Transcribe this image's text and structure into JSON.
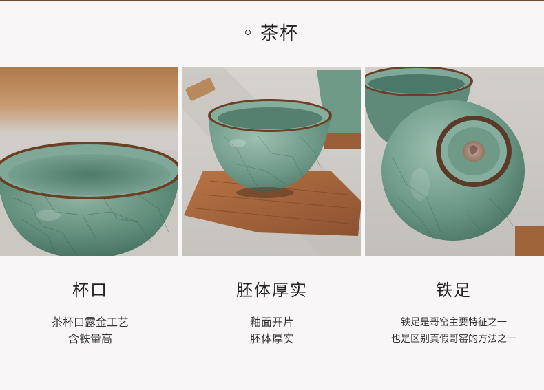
{
  "header": {
    "title": "茶杯"
  },
  "colors": {
    "celadon": "#6f9a88",
    "celadon_dark": "#3f6a5c",
    "rim_brown": "#6b3f24",
    "wood": "#a7683d",
    "cloth": "#c9c7c2"
  },
  "features": [
    {
      "title": "杯口",
      "lines": [
        "茶杯口露金工艺",
        "含铁量高"
      ]
    },
    {
      "title": "胚体厚实",
      "lines": [
        "釉面开片",
        "胚体厚实"
      ]
    },
    {
      "title": "铁足",
      "lines": [
        "铁足是哥窑主要特征之一",
        "也是区别真假哥窑的方法之一"
      ]
    }
  ]
}
